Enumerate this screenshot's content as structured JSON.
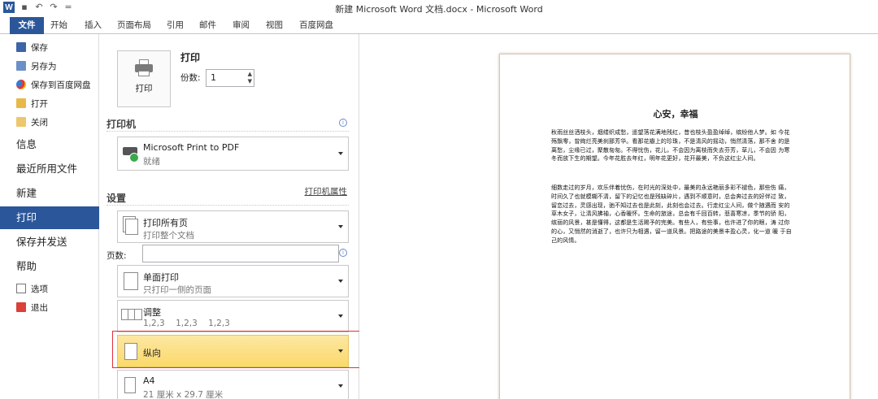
{
  "window": {
    "title": "新建 Microsoft Word 文档.docx - Microsoft Word",
    "app_icon": "word-logo",
    "quick_access": [
      "save-icon",
      "undo-icon",
      "redo-icon",
      "customize-icon"
    ]
  },
  "ribbon": {
    "tabs": [
      "文件",
      "开始",
      "插入",
      "页面布局",
      "引用",
      "邮件",
      "审阅",
      "视图",
      "百度网盘"
    ]
  },
  "nav": {
    "small_items": [
      {
        "label": "保存",
        "icon": "save-icon"
      },
      {
        "label": "另存为",
        "icon": "save-as-icon"
      },
      {
        "label": "保存到百度网盘",
        "icon": "baidu-cloud-icon"
      },
      {
        "label": "打开",
        "icon": "open-folder-icon"
      },
      {
        "label": "关闭",
        "icon": "close-folder-icon"
      }
    ],
    "big_items": [
      "信息",
      "最近所用文件",
      "新建",
      "打印",
      "保存并发送",
      "帮助"
    ],
    "active": "打印",
    "bottom_items": [
      {
        "label": "选项",
        "icon": "options-icon"
      },
      {
        "label": "退出",
        "icon": "exit-icon"
      }
    ]
  },
  "print": {
    "heading": "打印",
    "button_label": "打印",
    "copies_label": "份数:",
    "copies_value": "1",
    "printer_section": "打印机",
    "printer_name": "Microsoft Print to PDF",
    "printer_status": "就绪",
    "printer_props": "打印机属性",
    "settings_section": "设置",
    "range_title": "打印所有页",
    "range_desc": "打印整个文档",
    "pages_label": "页数:",
    "pages_value": "",
    "sides_title": "单面打印",
    "sides_desc": "只打印一侧的页面",
    "collate_title": "调整",
    "collate_desc": "1,2,3    1,2,3    1,2,3",
    "orientation_title": "纵向",
    "paper_title": "A4",
    "paper_desc": "21 厘米 x 29.7 厘米"
  },
  "document": {
    "title": "心安，幸福",
    "paragraphs": [
      "秋雨丝丝洒枝头，烟缕织成愁，遥望落花满地残红，昔也枝头盈盈绰绰，缤纷他人梦。如 今花殇飘零，曾绚烂亮美刹那芳华。看那花瓣上的珍珠，不是清风的摇动，悄然清落，那不舍 的是离愁，尘缘已过，聚散匆匆。不得忧伤，花儿，不会因为离枝而失去芬芳，草儿，不会因 为寒冬而放下生的期望。今年花胜去年红，明年花更好，花开最美，不负这红尘人间。",
      "细数走过的岁月，欢乐伴着忧伤，在时光的深处中，最美的永远艳丽多彩不褪色，那些伤 痛，时间久了也就模糊不清，留下的记忆也是残缺碎片，遇到不顺意时，总会奔过去的好伴过 致，留恋过去，灵感出现，驰不知过去也是此刻，此刻也会过去。行走红尘人间，做个随遇而 安的草木女子，让清风拂袖，心香暖怀。生命的旅途，总会有千回百转，悲喜寒凉，季节的骄 阳，缤丽的风景，甚是懂得，这都是生活赐予的完美。有些人，有些事，也许进了你的眼，涛 过你的心，又悄然的消逝了，也许只为相遇，留一道风景。把路途的美景丰盈心灵，化一道 暖 于自己的风情。"
    ]
  }
}
